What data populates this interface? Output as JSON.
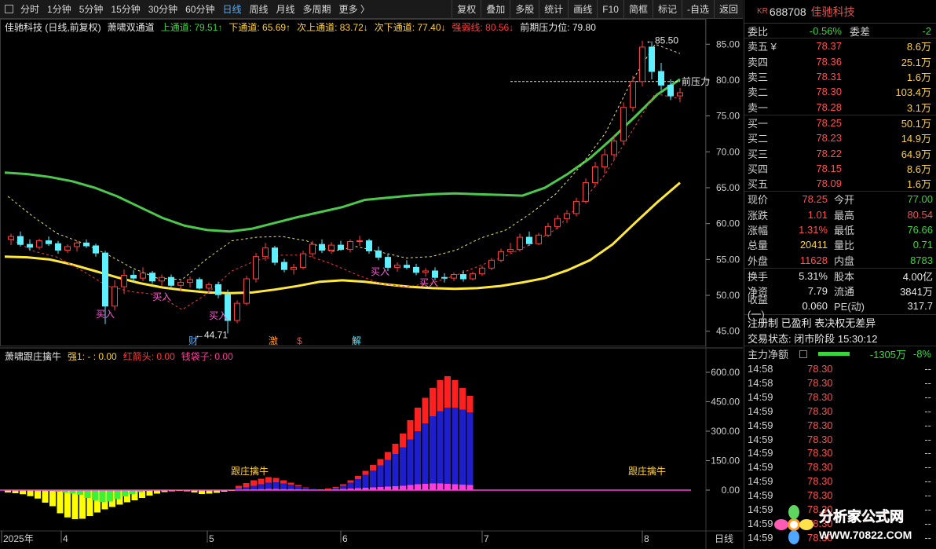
{
  "toolbar": {
    "left_items": [
      "分时",
      "1分钟",
      "5分钟",
      "15分钟",
      "30分钟",
      "60分钟",
      "日线",
      "周线",
      "月线",
      "多周期",
      "更多 〉"
    ],
    "active": "日线",
    "right_items": [
      "复权",
      "叠加",
      "多股",
      "统计",
      "画线",
      "F10",
      "简框",
      "标记",
      "-自选",
      "返回"
    ]
  },
  "main_legend": {
    "stock": "佳驰科技 (日线,前复权)",
    "indicator": "萧啸双通道",
    "items": [
      {
        "label": "上通道: 79.51↑",
        "color": "#3cd43c"
      },
      {
        "label": "下通道: 65.69↑",
        "color": "#ffd23c"
      },
      {
        "label": "次上通道: 83.72↓",
        "color": "#ffd23c"
      },
      {
        "label": "次下通道: 77.40↓",
        "color": "#ffd23c"
      },
      {
        "label": "强弱线: 80.56↓",
        "color": "#ff3c3c"
      },
      {
        "label": "前期压力位: 79.80",
        "color": "#e8e8e8"
      }
    ]
  },
  "main_axis": {
    "ticks": [
      "85.00",
      "80.00",
      "75.00",
      "70.00",
      "65.00",
      "60.00",
      "55.00",
      "50.00",
      "45.00"
    ]
  },
  "main_annotations": {
    "high": "85.50",
    "low": "44.71",
    "pressure": "前压力",
    "buy": "买入",
    "events": [
      "财",
      "激",
      "$",
      "解"
    ]
  },
  "sub_legend": {
    "indicator": "萧啸跟庄擒牛",
    "items": [
      {
        "label": "强1: - : 0.00",
        "color": "#ffd23c"
      },
      {
        "label": "红箭头: 0.00",
        "color": "#ff3c3c"
      },
      {
        "label": "钱袋子: 0.00",
        "color": "#ff3c9c"
      }
    ],
    "tag": "跟庄擒牛"
  },
  "sub_axis": {
    "ticks": [
      "600.00",
      "450.00",
      "300.00",
      "150.00",
      "0.00"
    ]
  },
  "x_axis": {
    "labels": [
      "2025年",
      "4",
      "5",
      "6",
      "7",
      "8"
    ],
    "period": "日线"
  },
  "chart_data": {
    "type": "candlestick",
    "price_range": [
      43,
      87
    ],
    "candles": [
      [
        57.8,
        58.6,
        57.0,
        58.2
      ],
      [
        58.2,
        58.9,
        56.8,
        57.1
      ],
      [
        57.1,
        57.8,
        56.2,
        56.7
      ],
      [
        56.7,
        57.9,
        56.4,
        57.6
      ],
      [
        57.6,
        58.2,
        56.9,
        57.2
      ],
      [
        57.2,
        57.6,
        55.8,
        56.3
      ],
      [
        56.3,
        57.1,
        55.9,
        56.8
      ],
      [
        56.8,
        57.6,
        56.1,
        57.3
      ],
      [
        57.3,
        57.8,
        56.6,
        56.9
      ],
      [
        56.9,
        57.2,
        55.4,
        55.9
      ],
      [
        55.9,
        56.2,
        46.0,
        48.5
      ],
      [
        48.5,
        52.1,
        47.9,
        51.2
      ],
      [
        51.2,
        53.6,
        50.2,
        52.8
      ],
      [
        52.8,
        53.5,
        51.9,
        52.4
      ],
      [
        52.4,
        53.9,
        52.0,
        53.1
      ],
      [
        53.1,
        53.4,
        51.6,
        52.0
      ],
      [
        52.0,
        52.9,
        51.3,
        52.5
      ],
      [
        52.5,
        52.9,
        50.9,
        51.4
      ],
      [
        51.4,
        52.1,
        50.6,
        51.8
      ],
      [
        51.8,
        52.6,
        51.1,
        52.2
      ],
      [
        52.2,
        52.5,
        50.8,
        51.0
      ],
      [
        51.0,
        51.8,
        50.3,
        51.5
      ],
      [
        51.5,
        51.9,
        49.6,
        50.1
      ],
      [
        50.1,
        50.8,
        44.7,
        46.5
      ],
      [
        46.5,
        49.3,
        46.1,
        48.9
      ],
      [
        48.9,
        52.7,
        48.6,
        52.3
      ],
      [
        52.3,
        55.9,
        51.8,
        55.4
      ],
      [
        55.4,
        57.3,
        54.8,
        56.6
      ],
      [
        56.6,
        56.9,
        54.2,
        54.6
      ],
      [
        54.6,
        55.1,
        53.2,
        53.6
      ],
      [
        53.6,
        54.4,
        52.9,
        53.9
      ],
      [
        53.9,
        56.2,
        53.6,
        55.8
      ],
      [
        55.8,
        57.6,
        55.3,
        57.1
      ],
      [
        57.1,
        57.8,
        55.9,
        56.3
      ],
      [
        56.3,
        57.4,
        55.8,
        57.0
      ],
      [
        57.0,
        57.6,
        56.2,
        56.4
      ],
      [
        56.4,
        57.8,
        56.0,
        57.5
      ],
      [
        57.5,
        58.3,
        56.9,
        57.6
      ],
      [
        57.6,
        57.9,
        55.8,
        56.2
      ],
      [
        56.2,
        56.8,
        54.9,
        55.3
      ],
      [
        55.3,
        55.8,
        53.4,
        53.9
      ],
      [
        53.9,
        54.6,
        53.3,
        54.2
      ],
      [
        54.2,
        54.9,
        53.6,
        53.9
      ],
      [
        53.9,
        54.4,
        52.8,
        53.2
      ],
      [
        53.2,
        53.8,
        52.6,
        53.4
      ],
      [
        53.4,
        53.9,
        52.1,
        52.5
      ],
      [
        52.5,
        53.1,
        51.8,
        52.4
      ],
      [
        52.4,
        53.2,
        52.0,
        52.9
      ],
      [
        52.9,
        53.5,
        51.9,
        52.3
      ],
      [
        52.3,
        53.3,
        52.1,
        53.0
      ],
      [
        53.0,
        54.1,
        52.7,
        53.8
      ],
      [
        53.8,
        55.2,
        53.5,
        54.9
      ],
      [
        54.9,
        56.5,
        54.6,
        56.1
      ],
      [
        56.1,
        57.3,
        55.9,
        56.4
      ],
      [
        56.4,
        58.6,
        56.1,
        58.1
      ],
      [
        58.1,
        58.9,
        56.9,
        57.2
      ],
      [
        57.2,
        58.7,
        57.0,
        58.4
      ],
      [
        58.4,
        60.1,
        58.1,
        59.6
      ],
      [
        59.6,
        61.2,
        59.2,
        60.7
      ],
      [
        60.7,
        61.9,
        60.1,
        61.4
      ],
      [
        61.4,
        63.6,
        61.0,
        63.1
      ],
      [
        63.1,
        66.3,
        62.8,
        65.7
      ],
      [
        65.7,
        68.6,
        65.1,
        67.9
      ],
      [
        67.9,
        70.4,
        67.0,
        69.6
      ],
      [
        69.6,
        72.3,
        68.8,
        71.5
      ],
      [
        71.5,
        76.9,
        71.0,
        76.2
      ],
      [
        76.2,
        80.6,
        75.6,
        79.8
      ],
      [
        79.8,
        85.5,
        79.1,
        84.6
      ],
      [
        84.6,
        85.2,
        80.1,
        81.2
      ],
      [
        81.2,
        82.4,
        78.6,
        79.3
      ],
      [
        79.3,
        80.1,
        77.2,
        77.8
      ],
      [
        77.8,
        78.9,
        76.9,
        78.25
      ]
    ],
    "channels": {
      "upper_green": [
        67.1,
        66.9,
        66.5,
        65.9,
        65.0,
        63.8,
        62.3,
        60.8,
        59.7,
        59.1,
        58.9,
        59.3,
        60.1,
        60.9,
        61.6,
        62.3,
        63.3,
        63.6,
        63.9,
        64.1,
        64.2,
        64.1,
        64.0,
        63.9,
        65.0,
        66.9,
        69.1,
        71.9,
        74.9,
        78.0,
        80.1
      ],
      "lower_yellow": [
        55.4,
        55.3,
        55.0,
        54.3,
        53.4,
        52.5,
        51.7,
        51.1,
        50.7,
        50.4,
        50.3,
        50.4,
        50.8,
        51.3,
        51.9,
        52.1,
        51.9,
        51.5,
        51.2,
        51.0,
        50.9,
        51.0,
        51.3,
        51.8,
        52.4,
        53.5,
        54.9,
        57.1,
        60.1,
        63.0,
        65.7
      ],
      "inner_upper": [
        63.8,
        61.0,
        58.6,
        57.3,
        55.7,
        53.8,
        52.4,
        52.2,
        55.1,
        57.6,
        58.1,
        58.2,
        57.6,
        56.1,
        56.8,
        56.0,
        55.2,
        55.4,
        56.3,
        58.0,
        59.1,
        61.4,
        64.1,
        68.0,
        72.6,
        79.5,
        85.0,
        83.7
      ],
      "inner_lower": [
        58.1,
        56.2,
        55.3,
        53.4,
        51.3,
        50.5,
        50.1,
        48.0,
        50.2,
        53.4,
        54.9,
        55.6,
        55.6,
        54.4,
        52.9,
        51.6,
        51.2,
        51.7,
        52.8,
        54.2,
        55.5,
        57.1,
        59.2,
        62.8,
        66.9,
        72.5,
        78.1,
        77.4
      ]
    },
    "sub_bars": {
      "neg_yellow": [
        12,
        16,
        21,
        31,
        43,
        64,
        82,
        118,
        139,
        148,
        146,
        132,
        114,
        98,
        86,
        74,
        62,
        52,
        40,
        28,
        18,
        10,
        6,
        4,
        6,
        12,
        20,
        18,
        14,
        8,
        4
      ],
      "neg_green": [
        4,
        8,
        12,
        18,
        24,
        40,
        52,
        60,
        58,
        46,
        32,
        20,
        10,
        4
      ],
      "pos_red": [
        22,
        36,
        50,
        58,
        66,
        62,
        50,
        38,
        26,
        14,
        6,
        4,
        8,
        16,
        30,
        50,
        72,
        98,
        128,
        158,
        194,
        236,
        288,
        356,
        420,
        470,
        520,
        560,
        580,
        560,
        520,
        480
      ],
      "pos_blue": [
        8,
        14,
        22,
        30,
        38,
        40,
        34,
        28,
        20,
        12,
        6,
        2,
        4,
        10,
        22,
        38,
        56,
        78,
        100,
        126,
        154,
        184,
        218,
        258,
        300,
        340,
        376,
        402,
        420,
        420,
        410,
        396
      ],
      "pos_magenta": [
        2,
        3,
        4,
        5,
        6,
        6,
        5,
        5,
        4,
        3,
        2,
        2,
        3,
        4,
        6,
        8,
        10,
        12,
        14,
        16,
        18,
        20,
        22,
        26,
        30,
        32,
        34,
        34,
        32,
        30,
        28,
        26
      ]
    }
  },
  "panel": {
    "kr": "KR",
    "code": "688708",
    "name": "佳驰科技",
    "ratio": {
      "label1": "委比",
      "val1": "-0.56%",
      "label2": "委差",
      "val2": "-2"
    },
    "asks": [
      {
        "label": "卖五 ¥",
        "price": "78.37",
        "vol": "8.6万"
      },
      {
        "label": "卖四",
        "price": "78.36",
        "vol": "25.1万"
      },
      {
        "label": "卖三",
        "price": "78.31",
        "vol": "1.6万"
      },
      {
        "label": "卖二",
        "price": "78.30",
        "vol": "103.4万"
      },
      {
        "label": "卖一",
        "price": "78.28",
        "vol": "3.1万"
      }
    ],
    "bids": [
      {
        "label": "买一",
        "price": "78.25",
        "vol": "50.1万"
      },
      {
        "label": "买二",
        "price": "78.23",
        "vol": "14.9万"
      },
      {
        "label": "买三",
        "price": "78.22",
        "vol": "64.9万"
      },
      {
        "label": "买四",
        "price": "78.15",
        "vol": "8.6万"
      },
      {
        "label": "买五",
        "price": "78.09",
        "vol": "1.6万"
      }
    ],
    "quote": [
      {
        "l1": "现价",
        "v1": "78.25",
        "c1": "red",
        "l2": "今开",
        "v2": "77.00",
        "c2": "green"
      },
      {
        "l1": "涨跌",
        "v1": "1.01",
        "c1": "red",
        "l2": "最高",
        "v2": "80.54",
        "c2": "red"
      },
      {
        "l1": "涨幅",
        "v1": "1.31%",
        "c1": "red",
        "l2": "最低",
        "v2": "76.66",
        "c2": "green"
      },
      {
        "l1": "总量",
        "v1": "20411",
        "c1": "yellow",
        "l2": "量比",
        "v2": "0.71",
        "c2": "green"
      },
      {
        "l1": "外盘",
        "v1": "11628",
        "c1": "red",
        "l2": "内盘",
        "v2": "8783",
        "c2": "green"
      }
    ],
    "stats": [
      {
        "l1": "换手",
        "v1": "5.31%",
        "l2": "股本",
        "v2": "4.00亿"
      },
      {
        "l1": "净资",
        "v1": "7.79",
        "l2": "流通",
        "v2": "3841万"
      },
      {
        "l1": "收益(一)",
        "v1": "0.060",
        "l2": "PE(动)",
        "v2": "317.7"
      }
    ],
    "flags": "注册制 已盈利 表决权无差异",
    "status": "交易状态: 闭市阶段 15:30:12",
    "main_flow": {
      "label": "主力净额",
      "value": "-1305万",
      "pct": "-8%"
    },
    "ticks": [
      {
        "time": "14:58",
        "price": "78.30",
        "vol": "--"
      },
      {
        "time": "14:58",
        "price": "78.30",
        "vol": "--"
      },
      {
        "time": "14:59",
        "price": "78.30",
        "vol": "--"
      },
      {
        "time": "14:59",
        "price": "78.30",
        "vol": "--"
      },
      {
        "time": "14:59",
        "price": "78.30",
        "vol": "--"
      },
      {
        "time": "14:59",
        "price": "78.30",
        "vol": "--"
      },
      {
        "time": "14:59",
        "price": "78.30",
        "vol": "--"
      },
      {
        "time": "14:59",
        "price": "78.30",
        "vol": "--"
      },
      {
        "time": "14:59",
        "price": "78.30",
        "vol": "--"
      },
      {
        "time": "14:59",
        "price": "78.30",
        "vol": "--"
      },
      {
        "time": "14:59",
        "price": "78.30",
        "vol": "--"
      },
      {
        "time": "14:59",
        "price": "78.30",
        "vol": "--"
      },
      {
        "time": "14:59",
        "price": "78.30",
        "vol": "--"
      }
    ]
  },
  "watermark": {
    "title": "分析家公式网",
    "url": "WWW.70822.COM"
  }
}
